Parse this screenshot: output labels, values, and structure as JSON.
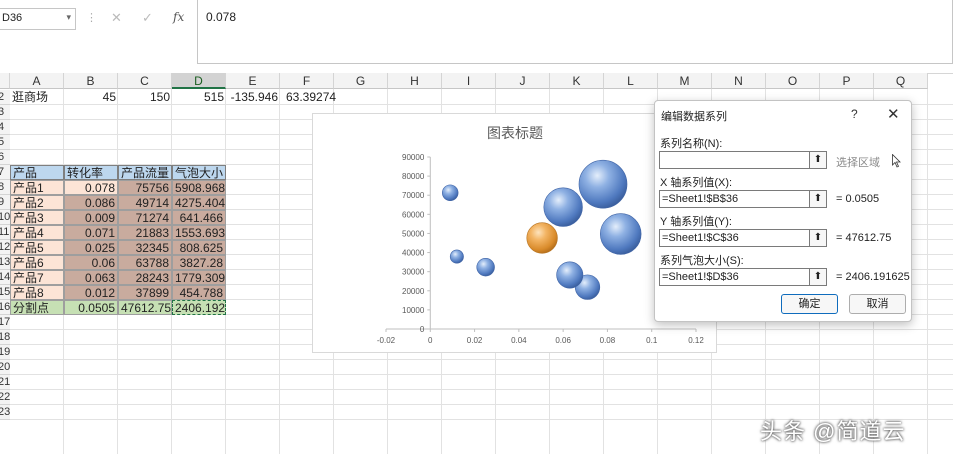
{
  "formula_bar": {
    "name_box": "D36",
    "name_box_arrow": "▾",
    "separator": "⋮",
    "cancel_glyph": "✕",
    "enter_glyph": "✓",
    "fx_label": "fx",
    "formula_value": "0.078"
  },
  "columns": [
    "A",
    "B",
    "C",
    "D",
    "E",
    "F",
    "G",
    "H",
    "I",
    "J",
    "K",
    "L",
    "M",
    "N",
    "O",
    "P",
    "Q"
  ],
  "rows": [
    "2",
    "3",
    "4",
    "5",
    "6",
    "7",
    "8",
    "9",
    "10",
    "11",
    "12",
    "13",
    "14",
    "15",
    "16",
    "17",
    "18",
    "19",
    "20",
    "21",
    "22",
    "23"
  ],
  "row2": {
    "a": "逛商场",
    "b": "45",
    "c": "150",
    "d": "515",
    "e": "-135.946",
    "f": "63.39274"
  },
  "table": {
    "headers": [
      "产品",
      "转化率",
      "产品流量",
      "气泡大小"
    ],
    "rows": [
      [
        "产品1",
        "0.078",
        "75756",
        "5908.968"
      ],
      [
        "产品2",
        "0.086",
        "49714",
        "4275.404"
      ],
      [
        "产品3",
        "0.009",
        "71274",
        "641.466"
      ],
      [
        "产品4",
        "0.071",
        "21883",
        "1553.693"
      ],
      [
        "产品5",
        "0.025",
        "32345",
        "808.625"
      ],
      [
        "产品6",
        "0.06",
        "63788",
        "3827.28"
      ],
      [
        "产品7",
        "0.063",
        "28243",
        "1779.309"
      ],
      [
        "产品8",
        "0.012",
        "37899",
        "454.788"
      ]
    ],
    "split": [
      "分割点",
      "0.0505",
      "47612.75",
      "2406.192"
    ]
  },
  "chart": {
    "title": "图表标题"
  },
  "chart_data": {
    "type": "scatter",
    "subtype": "bubble",
    "title": "图表标题",
    "xlim": [
      -0.02,
      0.12
    ],
    "ylim": [
      0,
      90000
    ],
    "x_ticks": [
      "-0.02",
      "0",
      "0.02",
      "0.04",
      "0.06",
      "0.08",
      "0.1",
      "0.12"
    ],
    "y_ticks": [
      "0",
      "10000",
      "20000",
      "30000",
      "40000",
      "50000",
      "60000",
      "70000",
      "80000",
      "90000"
    ],
    "series": [
      {
        "color": "#5b8bd0",
        "points": [
          {
            "x": 0.078,
            "y": 75756,
            "size": 5908.968
          },
          {
            "x": 0.086,
            "y": 49714,
            "size": 4275.404
          },
          {
            "x": 0.009,
            "y": 71274,
            "size": 641.466
          },
          {
            "x": 0.071,
            "y": 21883,
            "size": 1553.693
          },
          {
            "x": 0.025,
            "y": 32345,
            "size": 808.625
          },
          {
            "x": 0.06,
            "y": 63788,
            "size": 3827.28
          },
          {
            "x": 0.063,
            "y": 28243,
            "size": 1779.309
          },
          {
            "x": 0.012,
            "y": 37899,
            "size": 454.788
          }
        ]
      },
      {
        "color": "#f0a040",
        "points": [
          {
            "x": 0.0505,
            "y": 47612.75,
            "size": 2406.192
          }
        ]
      }
    ]
  },
  "dialog": {
    "title": "编辑数据系列",
    "help": "?",
    "close": "✕",
    "name_label": "系列名称(N):",
    "name_value": "",
    "name_hint": "选择区域",
    "x_label": "X 轴系列值(X):",
    "x_value": "=Sheet1!$B$36",
    "x_result": "= 0.0505",
    "y_label": "Y 轴系列值(Y):",
    "y_value": "=Sheet1!$C$36",
    "y_result": "= 47612.75",
    "size_label": "系列气泡大小(S):",
    "size_value": "=Sheet1!$D$36",
    "size_result": "= 2406.191625",
    "range_glyph": "⬆",
    "ok": "确定",
    "cancel": "取消"
  },
  "watermark": "头条 @简道云"
}
